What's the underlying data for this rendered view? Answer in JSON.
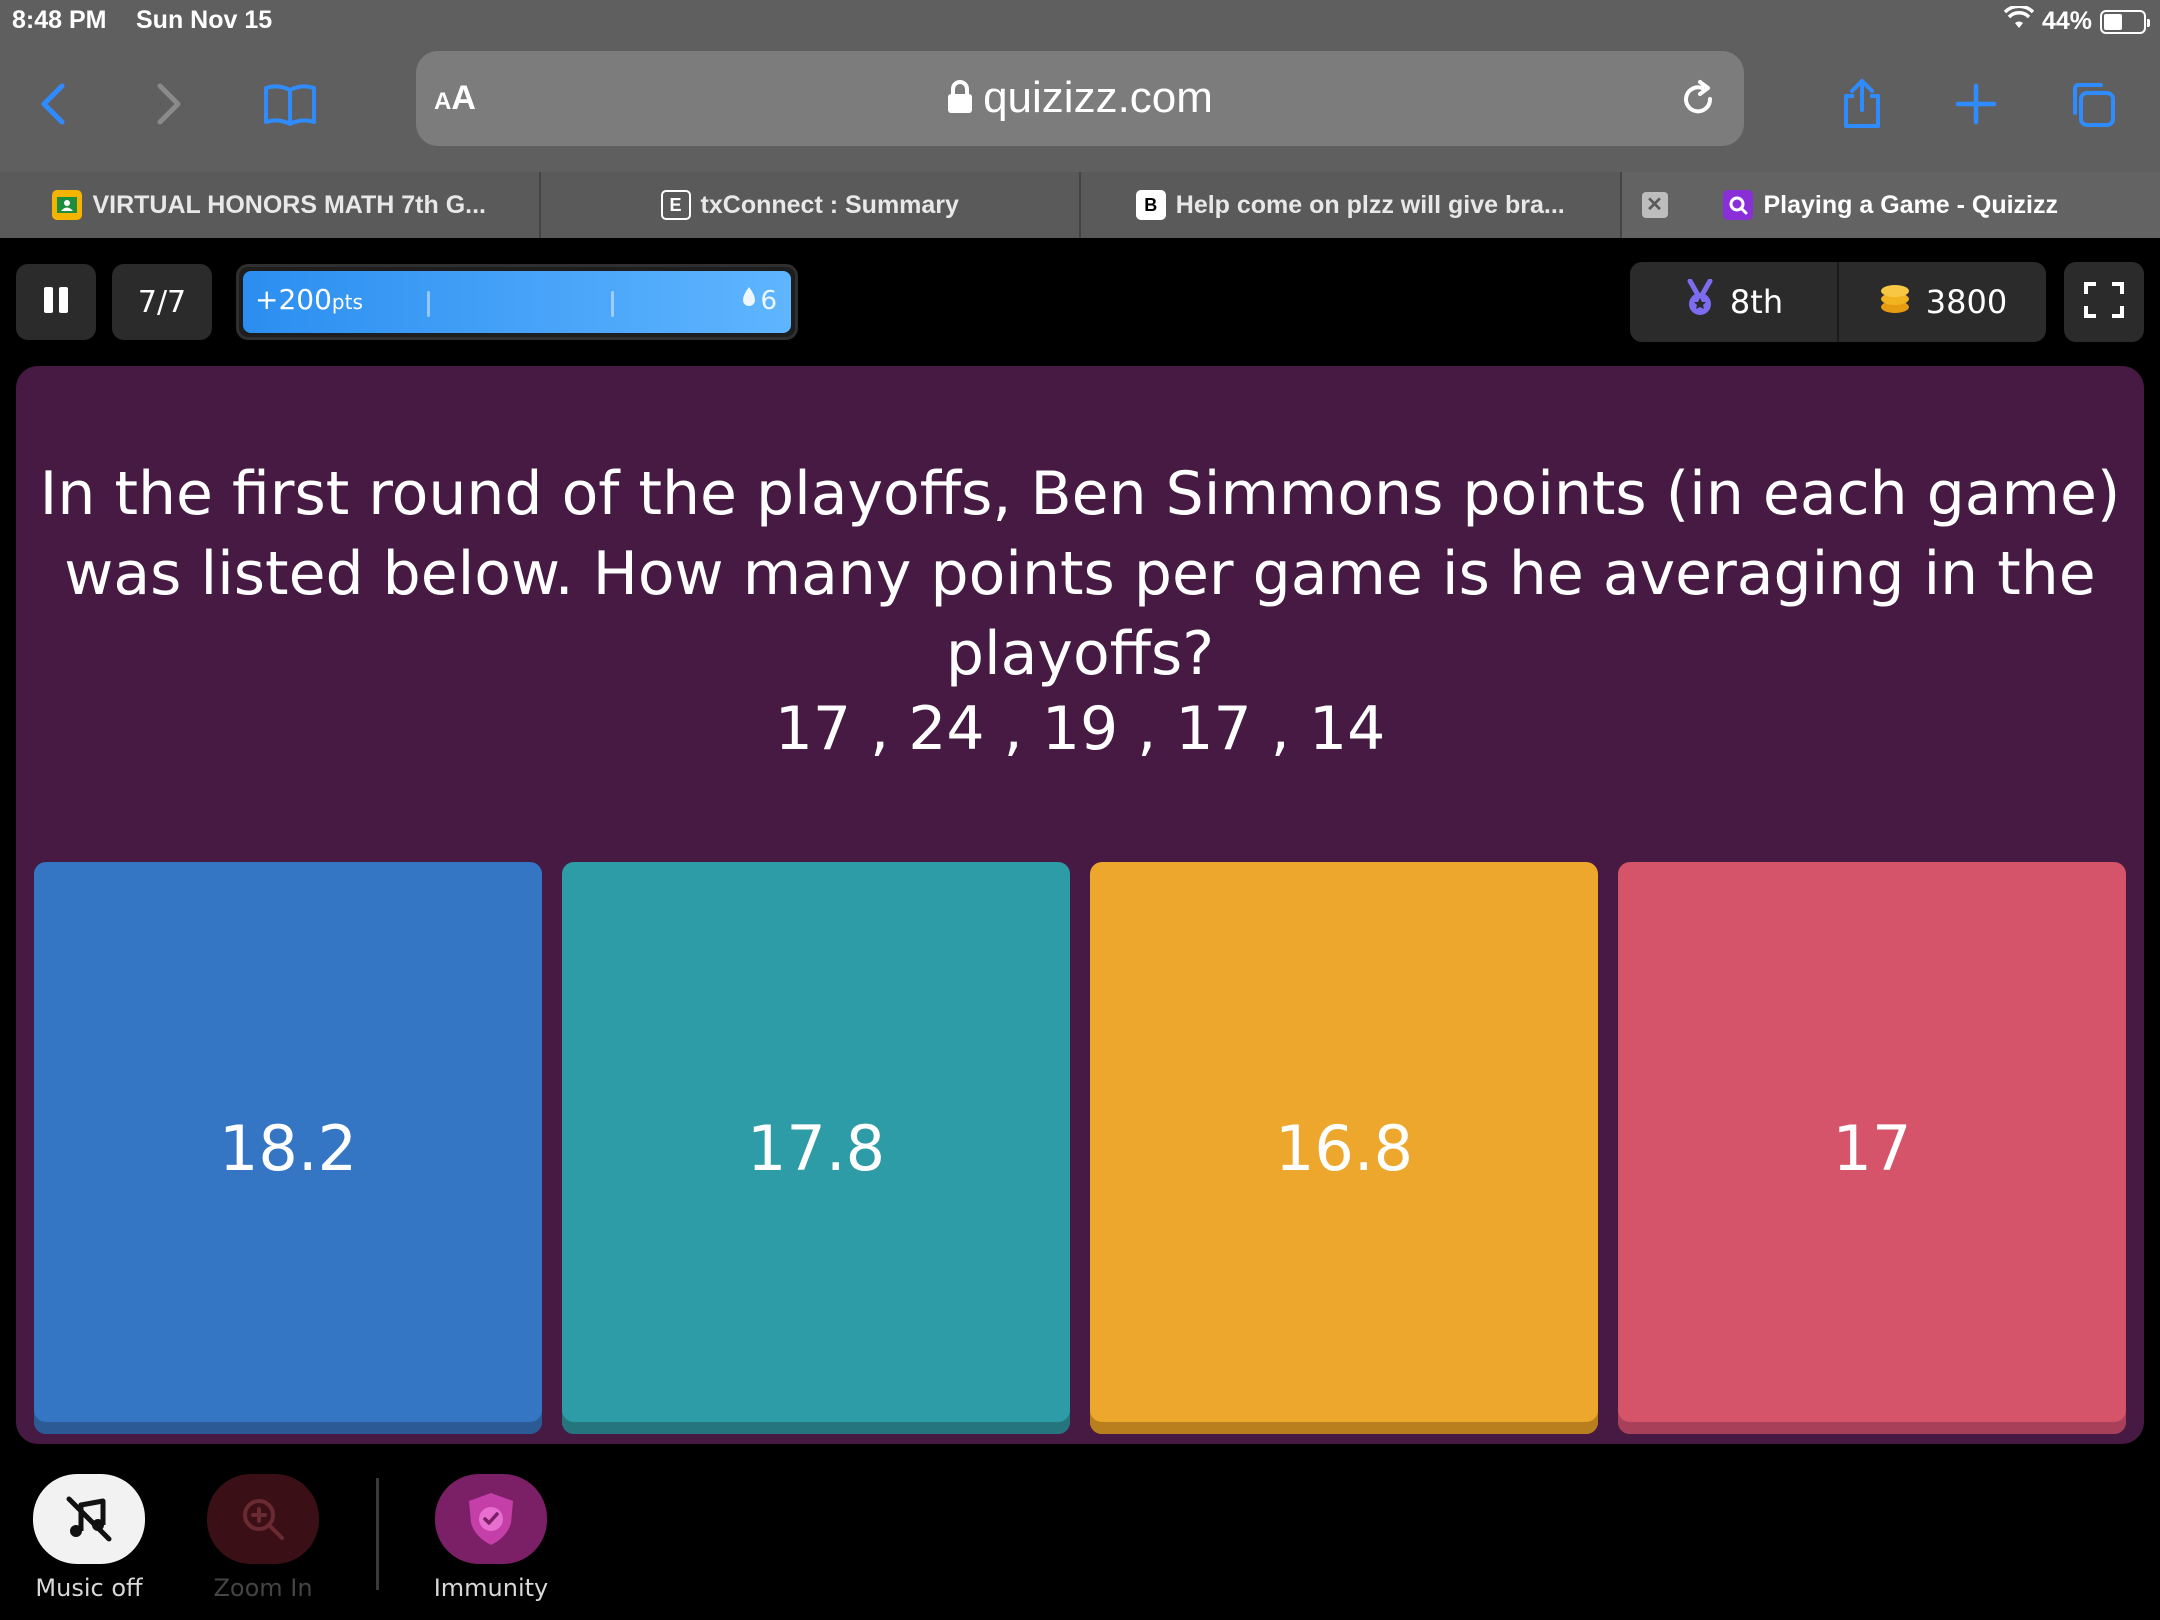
{
  "status": {
    "time": "8:48 PM",
    "date": "Sun Nov 15",
    "battery": "44%"
  },
  "browser": {
    "aa_label_small": "A",
    "aa_label": "A",
    "url": "quizizz.com",
    "tabs": [
      {
        "label": "VIRTUAL HONORS MATH 7th G...",
        "icon": "classroom-icon"
      },
      {
        "label": "txConnect : Summary",
        "favicon_letter": "E"
      },
      {
        "label": "Help come on plzz will give bra...",
        "favicon_letter": "B"
      },
      {
        "label": "Playing a Game - Quizizz",
        "icon": "quizizz-icon"
      }
    ]
  },
  "game": {
    "question_counter": "7/7",
    "points_label": "+200",
    "points_unit": "pts",
    "streak": "6",
    "rank": "8th",
    "score": "3800",
    "question": "In the first round of the playoffs, Ben Simmons points (in each game) was listed below. How many points per game is he averaging in the playoffs?",
    "question_numbers": "17 , 24 , 19 , 17 , 14",
    "answers": [
      {
        "text": "18.2",
        "color": "#3476c4"
      },
      {
        "text": "17.8",
        "color": "#2d9ca6"
      },
      {
        "text": "16.8",
        "color": "#eca72c"
      },
      {
        "text": "17",
        "color": "#d6546a"
      }
    ]
  },
  "powerups": {
    "music": "Music off",
    "zoom": "Zoom In",
    "immunity": "Immunity"
  }
}
